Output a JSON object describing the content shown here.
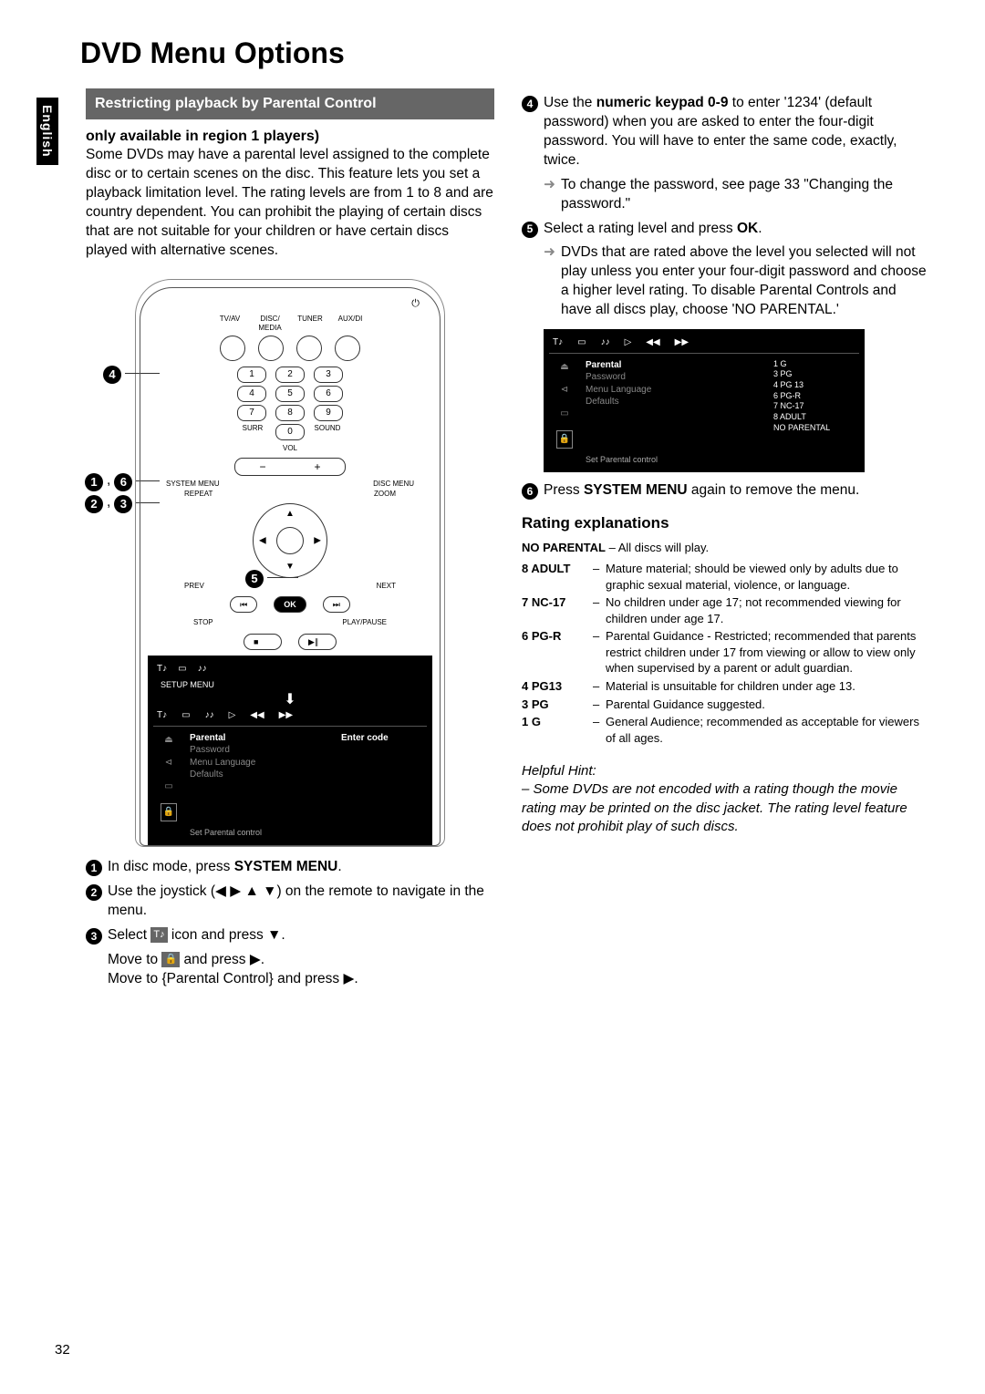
{
  "page_title": "DVD Menu Options",
  "language_tab": "English",
  "page_number": "32",
  "section_header": "Restricting playback by Parental Control",
  "subhead": "only available in region 1 players)",
  "intro_para": "Some DVDs may have a parental level assigned to the complete disc or to certain scenes on the disc.  This feature lets you set a playback limitation level. The rating levels are from 1 to 8 and are country dependent.  You can prohibit the playing of certain discs that are not suitable for your children or have certain discs played with alternative scenes.",
  "remote": {
    "sources": [
      "TV/AV",
      "DISC/ MEDIA",
      "TUNER",
      "AUX/DI"
    ],
    "numpad": [
      [
        "1",
        "2",
        "3"
      ],
      [
        "4",
        "5",
        "6"
      ],
      [
        "7",
        "8",
        "9"
      ],
      [
        "",
        "0",
        ""
      ]
    ],
    "surr": "SURR",
    "sound": "SOUND",
    "vol": "VOL",
    "system_menu": "SYSTEM MENU",
    "disc_menu": "DISC MENU",
    "repeat": "REPEAT",
    "zoom": "ZOOM",
    "prev": "PREV",
    "next": "NEXT",
    "ok": "OK",
    "stop": "STOP",
    "play_pause": "PLAY/PAUSE"
  },
  "callouts": {
    "c4": "4",
    "c16_left": "1",
    "c16_right": "6",
    "c23_left": "2",
    "c23_right": "3",
    "c5": "5"
  },
  "setup_menu_label": "SETUP MENU",
  "menu_screen1": {
    "mid_items": [
      "Parental",
      "Password",
      "Menu Language",
      "Defaults"
    ],
    "mid_hl_index": 0,
    "right": "Enter code",
    "foot": "Set  Parental  control"
  },
  "menu_screen2": {
    "mid_items": [
      "Parental",
      "Password",
      "Menu Language",
      "Defaults"
    ],
    "mid_hl_index": 0,
    "right_lines": [
      "1 G",
      "3 PG",
      "4 PG 13",
      "6 PG-R",
      "7 NC-17",
      "8 ADULT",
      "NO PARENTAL"
    ],
    "foot": "Set  Parental  control"
  },
  "steps": {
    "s1": "In disc mode, press ",
    "s1_bold": "SYSTEM MENU",
    "s1_tail": ".",
    "s2": "Use the joystick (◀ ▶ ▲ ▼) on the remote to navigate in the menu.",
    "s3a": "Select ",
    "s3a_tail": " icon and press ▼.",
    "s3b_pre": "Move to ",
    "s3b_tail": " and press ▶.",
    "s3c": "Move to {Parental Control} and press ▶.",
    "s4_pre": "Use the ",
    "s4_bold": "numeric keypad 0-9",
    "s4_tail": " to enter '1234' (default password) when you are asked to enter the four-digit password. You will have to enter the same code, exactly, twice.",
    "s4_arrow": "To change the password, see page 33 \"Changing the password.\"",
    "s5_pre": "Select a rating level and press ",
    "s5_bold": "OK",
    "s5_tail": ".",
    "s5_arrow": "DVDs that are rated above the level you selected will not play unless you enter your four-digit password and choose a higher level rating.  To disable Parental Controls and have all discs play, choose 'NO PARENTAL.'",
    "s6_pre": "Press ",
    "s6_bold": "SYSTEM MENU",
    "s6_tail": " again to remove the menu."
  },
  "ratings_title": "Rating explanations",
  "no_parental_line_bold": "NO PARENTAL",
  "no_parental_line_tail": " – All discs will play.",
  "ratings": [
    {
      "label": "8 ADULT",
      "desc": "Mature material; should be viewed only by adults due to graphic sexual material, violence, or language."
    },
    {
      "label": "7 NC-17",
      "desc": "No children under age 17; not recommended viewing for children under age 17."
    },
    {
      "label": "6 PG-R",
      "desc": "Parental Guidance - Restricted; recommended that parents restrict children under 17 from viewing or allow to view only when supervised by a parent or adult guardian."
    },
    {
      "label": "4 PG13",
      "desc": "Material is unsuitable for children under age 13."
    },
    {
      "label": "3 PG",
      "desc": "Parental Guidance suggested."
    },
    {
      "label": "1 G",
      "desc": "General Audience; recommended as acceptable for viewers of all ages."
    }
  ],
  "hint_title": "Helpful Hint:",
  "hint_body": "– Some DVDs are not encoded with a rating though the movie rating may be printed on the disc jacket.  The rating level feature does not prohibit play of such discs."
}
